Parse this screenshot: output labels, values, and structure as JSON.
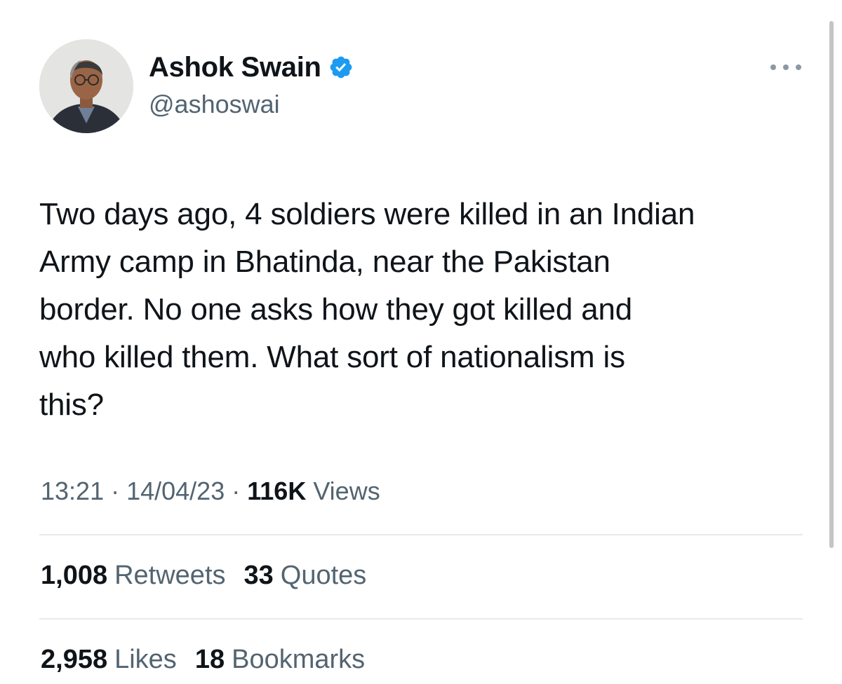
{
  "author": {
    "display_name": "Ashok Swain",
    "handle": "@ashoswai",
    "verified_icon": "verified-badge-icon",
    "verified_color": "#1d9bf0"
  },
  "menu": {
    "more_icon": "more-options-icon"
  },
  "tweet": {
    "text": "Two days ago, 4 soldiers were killed in an Indian\nArmy camp in Bhatinda, near the Pakistan\nborder. No one asks how they got killed and\nwho killed them. What sort of nationalism is\nthis?"
  },
  "meta": {
    "time": "13:21",
    "date": "14/04/23",
    "separator": "·",
    "views_count": "116K",
    "views_label": "Views"
  },
  "stats": {
    "retweets_count": "1,008",
    "retweets_label": "Retweets",
    "quotes_count": "33",
    "quotes_label": "Quotes",
    "likes_count": "2,958",
    "likes_label": "Likes",
    "bookmarks_count": "18",
    "bookmarks_label": "Bookmarks"
  },
  "colors": {
    "text_primary": "#0f1419",
    "text_secondary": "#536471",
    "divider": "#e7e9ea",
    "accent": "#1d9bf0"
  }
}
